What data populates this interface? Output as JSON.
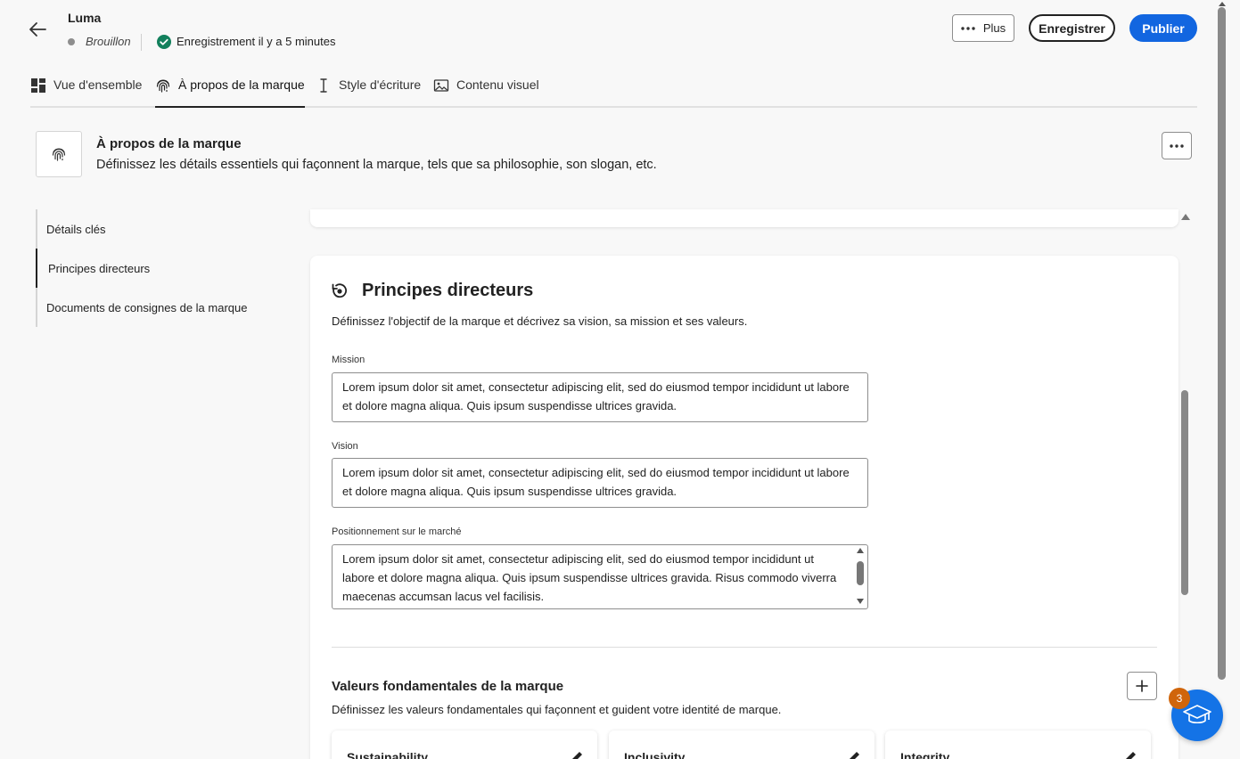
{
  "header": {
    "title": "Luma",
    "status": "Brouillon",
    "saved_text": "Enregistrement il y a 5 minutes",
    "more_label": "Plus",
    "save_label": "Enregistrer",
    "publish_label": "Publier"
  },
  "tabs": [
    {
      "label": "Vue d'ensemble",
      "icon": "dashboard-icon"
    },
    {
      "label": "À propos de la marque",
      "icon": "fingerprint-icon",
      "active": true
    },
    {
      "label": "Style d'écriture",
      "icon": "text-cursor-icon"
    },
    {
      "label": "Contenu visuel",
      "icon": "image-icon"
    }
  ],
  "section": {
    "title": "À propos de la marque",
    "description": "Définissez les détails essentiels qui façonnent la marque, tels que sa philosophie, son slogan, etc."
  },
  "leftnav": {
    "items": [
      {
        "label": "Détails clés"
      },
      {
        "label": "Principes directeurs",
        "active": true
      },
      {
        "label": "Documents de consignes de la marque"
      }
    ]
  },
  "principles": {
    "title": "Principes directeurs",
    "description": "Définissez l'objectif de la marque et décrivez sa vision, sa mission et ses valeurs.",
    "fields": [
      {
        "label": "Mission",
        "value": "Lorem ipsum dolor sit amet, consectetur adipiscing elit, sed do eiusmod tempor incididunt ut labore et dolore magna aliqua. Quis ipsum suspendisse ultrices gravida."
      },
      {
        "label": "Vision",
        "value": "Lorem ipsum dolor sit amet, consectetur adipiscing elit, sed do eiusmod tempor incididunt ut labore et dolore magna aliqua. Quis ipsum suspendisse ultrices gravida."
      },
      {
        "label": "Positionnement sur le marché",
        "value": "Lorem ipsum dolor sit amet, consectetur adipiscing elit, sed do eiusmod tempor incididunt ut labore et dolore magna aliqua. Quis ipsum suspendisse ultrices gravida. Risus commodo viverra maecenas accumsan lacus vel facilisis."
      }
    ]
  },
  "values": {
    "title": "Valeurs fondamentales de la marque",
    "description": "Définissez les valeurs fondamentales qui façonnent et guident votre identité de marque.",
    "cards": [
      {
        "name": "Sustainability"
      },
      {
        "name": "Inclusivity"
      },
      {
        "name": "Integrity"
      }
    ]
  },
  "help": {
    "badge": "3"
  },
  "colors": {
    "accent": "#1266e0",
    "success": "#12805c",
    "badge": "#d0650b"
  }
}
